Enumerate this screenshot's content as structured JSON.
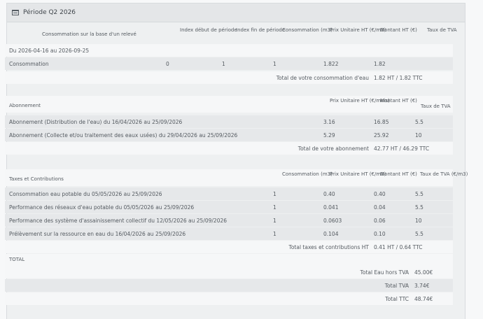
{
  "panel": {
    "title": "Période Q2 2026"
  },
  "consumption": {
    "header": {
      "label": "Consommation sur la base d'un relevé",
      "index_start": "Index début\nde période",
      "index_end": "Index fin\nde période",
      "consumption": "Consommation\n(m3)",
      "unit_price": "Prix Unitaire HT\n(€/m3)",
      "amount": "Montant HT\n(€)",
      "vat": "Taux\nde TVA"
    },
    "period": "Du 2026-04-16 au 2026-09-25",
    "row": {
      "label": "Consommation",
      "index_start": "0",
      "index_end": "1",
      "consumption": "1",
      "unit_price": "1.822",
      "amount": "1.82",
      "vat": ""
    },
    "total_label": "Total de votre consommation d'eau",
    "total_value": "1.82 HT / 1.82 TTC"
  },
  "subscription": {
    "header": {
      "label": "Abonnement",
      "unit_price": "Prix Unitaire HT\n(€/mois)",
      "amount": "Montant HT\n(€)",
      "vat": "Taux de TVA"
    },
    "rows": [
      {
        "label": "Abonnement (Distribution de l'eau) du 16/04/2026 au 25/09/2026",
        "unit_price": "3.16",
        "amount": "16.85",
        "vat": "5.5"
      },
      {
        "label": "Abonnement (Collecte et/ou traitement des eaux usées) du 29/04/2026 au 25/09/2026",
        "unit_price": "5.29",
        "amount": "25.92",
        "vat": "10"
      }
    ],
    "total_label": "Total de votre abonnement",
    "total_value": "42.77 HT / 46.29 TTC"
  },
  "taxes": {
    "header": {
      "label": "Taxes et Contributions",
      "consumption": "Consommation\n(m3)",
      "unit_price": "Prix Unitaire HT\n(€/m3)",
      "amount": "Montant HT\n(€)",
      "vat": "Taux de TVA\n(€/m3)"
    },
    "rows": [
      {
        "label": "Consommation eau potable du 05/05/2026 au 25/09/2026",
        "consumption": "1",
        "unit_price": "0.40",
        "amount": "0.40",
        "vat": "5.5"
      },
      {
        "label": "Performance des réseaux d'eau potable du 05/05/2026 au 25/09/2026",
        "consumption": "1",
        "unit_price": "0.041",
        "amount": "0.04",
        "vat": "5.5"
      },
      {
        "label": "Performance des système d'assainissement collectif du 12/05/2026 au 25/09/2026",
        "consumption": "1",
        "unit_price": "0.0603",
        "amount": "0.06",
        "vat": "10"
      },
      {
        "label": "Prélèvement sur la ressource en eau du 16/04/2026 au 25/09/2026",
        "consumption": "1",
        "unit_price": "0.104",
        "amount": "0.10",
        "vat": "5.5"
      }
    ],
    "total_label": "Total taxes et contributions HT",
    "total_value": "0.41 HT / 0.64 TTC"
  },
  "summary": {
    "label": "TOTAL",
    "rows": [
      {
        "label": "Total Eau hors TVA",
        "value": "45.00€"
      },
      {
        "label": "Total TVA",
        "value": "3.74€"
      },
      {
        "label": "Total TTC",
        "value": "48.74€"
      }
    ]
  }
}
